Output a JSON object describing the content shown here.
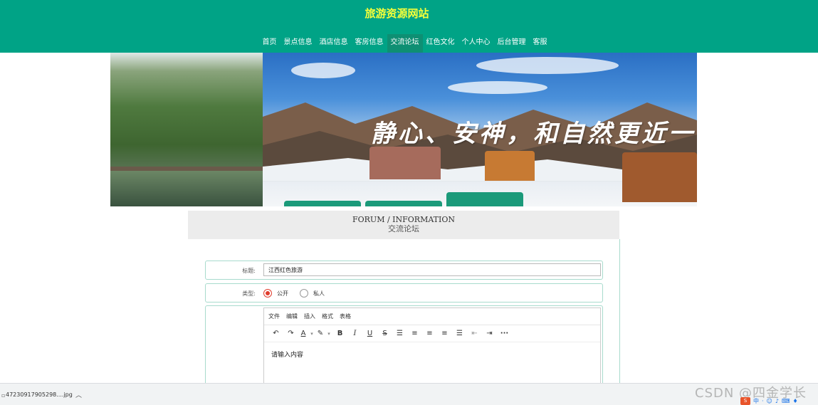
{
  "site": {
    "title": "旅游资源网站"
  },
  "nav": {
    "items": [
      {
        "label": "首页",
        "active": false
      },
      {
        "label": "景点信息",
        "active": false
      },
      {
        "label": "酒店信息",
        "active": false
      },
      {
        "label": "客房信息",
        "active": false
      },
      {
        "label": "交流论坛",
        "active": true
      },
      {
        "label": "红色文化",
        "active": false
      },
      {
        "label": "个人中心",
        "active": false
      },
      {
        "label": "后台管理",
        "active": false
      },
      {
        "label": "客服",
        "active": false
      }
    ]
  },
  "banner": {
    "slogan": "静心、安神，和自然更近一"
  },
  "forum": {
    "heading_en": "FORUM / INFORMATION",
    "heading_zh": "交流论坛"
  },
  "form": {
    "title_label": "标题:",
    "title_value": "江西红色旅游",
    "type_label": "类型:",
    "type_options": [
      {
        "label": "公开",
        "checked": true
      },
      {
        "label": "私人",
        "checked": false
      }
    ]
  },
  "editor": {
    "menus": [
      "文件",
      "编辑",
      "插入",
      "格式",
      "表格"
    ],
    "placeholder": "请输入内容"
  },
  "download_bar": {
    "file_name": "47230917905298....jpg"
  },
  "watermark": "CSDN @四金学长",
  "tray": {
    "ime": "中"
  },
  "colors": {
    "header_bg": "#00a386",
    "title_color": "#f6ff3a",
    "radio_checked": "#e03c2d",
    "row_border": "#a8dbcd"
  }
}
